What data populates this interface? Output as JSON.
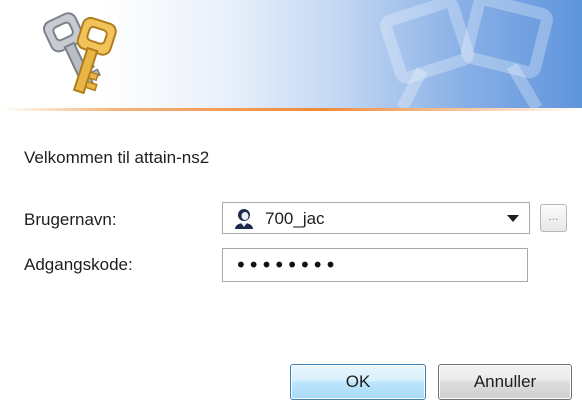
{
  "dialog": {
    "welcome_text": "Velkommen til attain-ns2",
    "username_label": "Brugernavn:",
    "password_label": "Adgangskode:",
    "username_value": "700_jac",
    "password_value": "••••••••",
    "browse_label": "...",
    "ok_label": "OK",
    "cancel_label": "Annuller"
  },
  "icons": {
    "banner_logo": "keys-icon",
    "user_avatar": "user-icon",
    "dropdown": "chevron-down-icon"
  },
  "colors": {
    "banner_blue": "#5f95dc",
    "accent_orange": "#ee8a3a",
    "ok_border": "#3c7fb1"
  }
}
